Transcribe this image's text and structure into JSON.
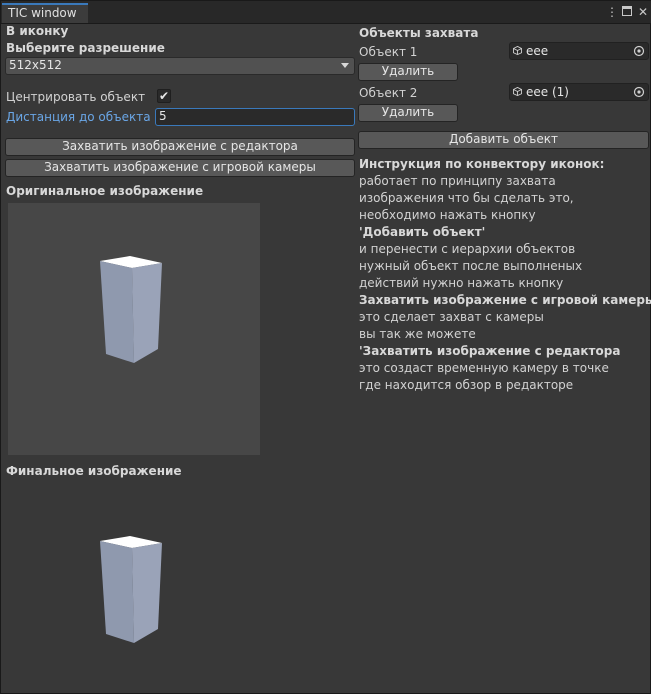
{
  "window": {
    "tab_title": "TIC window",
    "menu_icons": [
      "more-icon",
      "maximize-icon",
      "close-icon"
    ]
  },
  "left": {
    "section_title": "В иконку",
    "resolution_label": "Выберите разрешение",
    "resolution_value": "512x512",
    "center_label": "Центрировать объект",
    "center_checked": true,
    "distance_label": "Дистанция до объекта",
    "distance_value": "5",
    "capture_editor_button": "Захватить изображение с редактора",
    "capture_game_button": "Захватить изображение с игровой камеры",
    "original_label": "Оригинальное изображение",
    "final_label": "Финальное изображение"
  },
  "right": {
    "section_title": "Объекты захвата",
    "objects": [
      {
        "label": "Объект 1",
        "value": "eee",
        "delete_label": "Удалить"
      },
      {
        "label": "Объект 2",
        "value": "eee (1)",
        "delete_label": "Удалить"
      }
    ],
    "add_button": "Добавить объект",
    "instructions": [
      {
        "text": "Инструкция по конвектору иконок:",
        "bold": true
      },
      {
        "text": "работает по принципу захвата",
        "bold": false
      },
      {
        "text": "изображения что бы сделать это,",
        "bold": false
      },
      {
        "text": "необходимо нажать кнопку",
        "bold": false
      },
      {
        "text": "'Добавить объект'",
        "bold": true
      },
      {
        "text": "и перенести с иерархии объектов",
        "bold": false
      },
      {
        "text": "нужный объект после выполненых",
        "bold": false
      },
      {
        "text": "действий нужно нажать кнопку",
        "bold": false
      },
      {
        "text": "Захватить изображение с игровой камеры",
        "bold": true
      },
      {
        "text": "это сделает захват с камеры",
        "bold": false
      },
      {
        "text": "вы так же можете",
        "bold": false
      },
      {
        "text": "'Захватить изображение с редактора",
        "bold": true
      },
      {
        "text": "это создаст временную камеру в точке",
        "bold": false
      },
      {
        "text": "где находится обзор в редакторе",
        "bold": false
      }
    ]
  },
  "colors": {
    "background": "#383838",
    "accent": "#3a79bb",
    "label_highlight": "#6aa6e6",
    "cube_face": "#97a0b5",
    "cube_top": "#ffffff"
  }
}
